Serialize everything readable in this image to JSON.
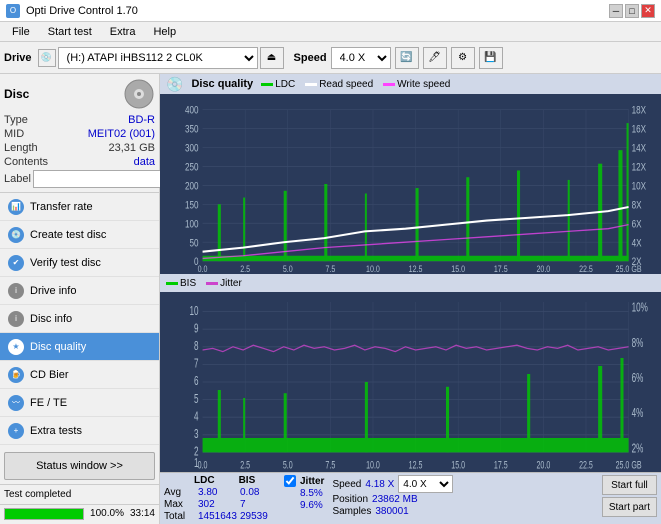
{
  "titleBar": {
    "title": "Opti Drive Control 1.70",
    "minBtn": "─",
    "maxBtn": "□",
    "closeBtn": "✕"
  },
  "menuBar": {
    "items": [
      "File",
      "Start test",
      "Extra",
      "Help"
    ]
  },
  "toolbar": {
    "driveLabel": "Drive",
    "driveValue": "(H:) ATAPI iHBS112  2 CL0K",
    "speedLabel": "Speed",
    "speedValue": "4.0 X"
  },
  "sidebar": {
    "discLabel": "Disc",
    "discInfo": {
      "type": {
        "label": "Type",
        "value": "BD-R"
      },
      "mid": {
        "label": "MID",
        "value": "MEIT02 (001)"
      },
      "length": {
        "label": "Length",
        "value": "23,31 GB"
      },
      "contents": {
        "label": "Contents",
        "value": "data"
      },
      "label": {
        "label": "Label",
        "value": ""
      }
    },
    "navItems": [
      {
        "id": "transfer-rate",
        "label": "Transfer rate",
        "active": false
      },
      {
        "id": "create-test-disc",
        "label": "Create test disc",
        "active": false
      },
      {
        "id": "verify-test-disc",
        "label": "Verify test disc",
        "active": false
      },
      {
        "id": "drive-info",
        "label": "Drive info",
        "active": false
      },
      {
        "id": "disc-info",
        "label": "Disc info",
        "active": false
      },
      {
        "id": "disc-quality",
        "label": "Disc quality",
        "active": true
      },
      {
        "id": "cd-bier",
        "label": "CD Bier",
        "active": false
      },
      {
        "id": "fe-te",
        "label": "FE / TE",
        "active": false
      },
      {
        "id": "extra-tests",
        "label": "Extra tests",
        "active": false
      }
    ],
    "statusBtn": "Status window >>",
    "statusText": "Test completed",
    "progressPct": "100.0",
    "progressText": "100.0%",
    "time": "33:14"
  },
  "chartArea": {
    "title": "Disc quality",
    "legend": [
      {
        "label": "LDC",
        "color": "#00cc00"
      },
      {
        "label": "Read speed",
        "color": "#ffffff"
      },
      {
        "label": "Write speed",
        "color": "#ff44ff"
      }
    ],
    "legend2": [
      {
        "label": "BIS",
        "color": "#00cc00"
      },
      {
        "label": "Jitter",
        "color": "#cc44cc"
      }
    ],
    "chart1": {
      "yMax": 400,
      "yLabelsLeft": [
        400,
        350,
        300,
        250,
        200,
        150,
        100,
        50,
        0
      ],
      "yLabelsRight": [
        "18X",
        "16X",
        "14X",
        "12X",
        "10X",
        "8X",
        "6X",
        "4X",
        "2X"
      ],
      "xLabels": [
        "0.0",
        "2.5",
        "5.0",
        "7.5",
        "10.0",
        "12.5",
        "15.0",
        "17.5",
        "20.0",
        "22.5",
        "25.0 GB"
      ]
    },
    "chart2": {
      "yMax": 10,
      "yLabelsLeft": [
        10,
        9,
        8,
        7,
        6,
        5,
        4,
        3,
        2,
        1
      ],
      "yLabelsRight": [
        "10%",
        "8%",
        "6%",
        "4%",
        "2%"
      ],
      "xLabels": [
        "0.0",
        "2.5",
        "5.0",
        "7.5",
        "10.0",
        "12.5",
        "15.0",
        "17.5",
        "20.0",
        "22.5",
        "25.0 GB"
      ]
    }
  },
  "stats": {
    "headers": [
      "LDC",
      "BIS",
      "Jitter"
    ],
    "rows": [
      {
        "label": "Avg",
        "ldc": "3.80",
        "bis": "0.08",
        "jitter": "8.5%"
      },
      {
        "label": "Max",
        "ldc": "302",
        "bis": "7",
        "jitter": "9.6%"
      },
      {
        "label": "Total",
        "ldc": "1451643",
        "bis": "29539",
        "jitter": ""
      }
    ],
    "jitterLabel": "Jitter",
    "speed": {
      "label": "Speed",
      "value": "4.18 X",
      "selectValue": "4.0 X"
    },
    "position": {
      "label": "Position",
      "value": "23862 MB"
    },
    "samples": {
      "label": "Samples",
      "value": "380001"
    },
    "startFull": "Start full",
    "startPart": "Start part"
  }
}
